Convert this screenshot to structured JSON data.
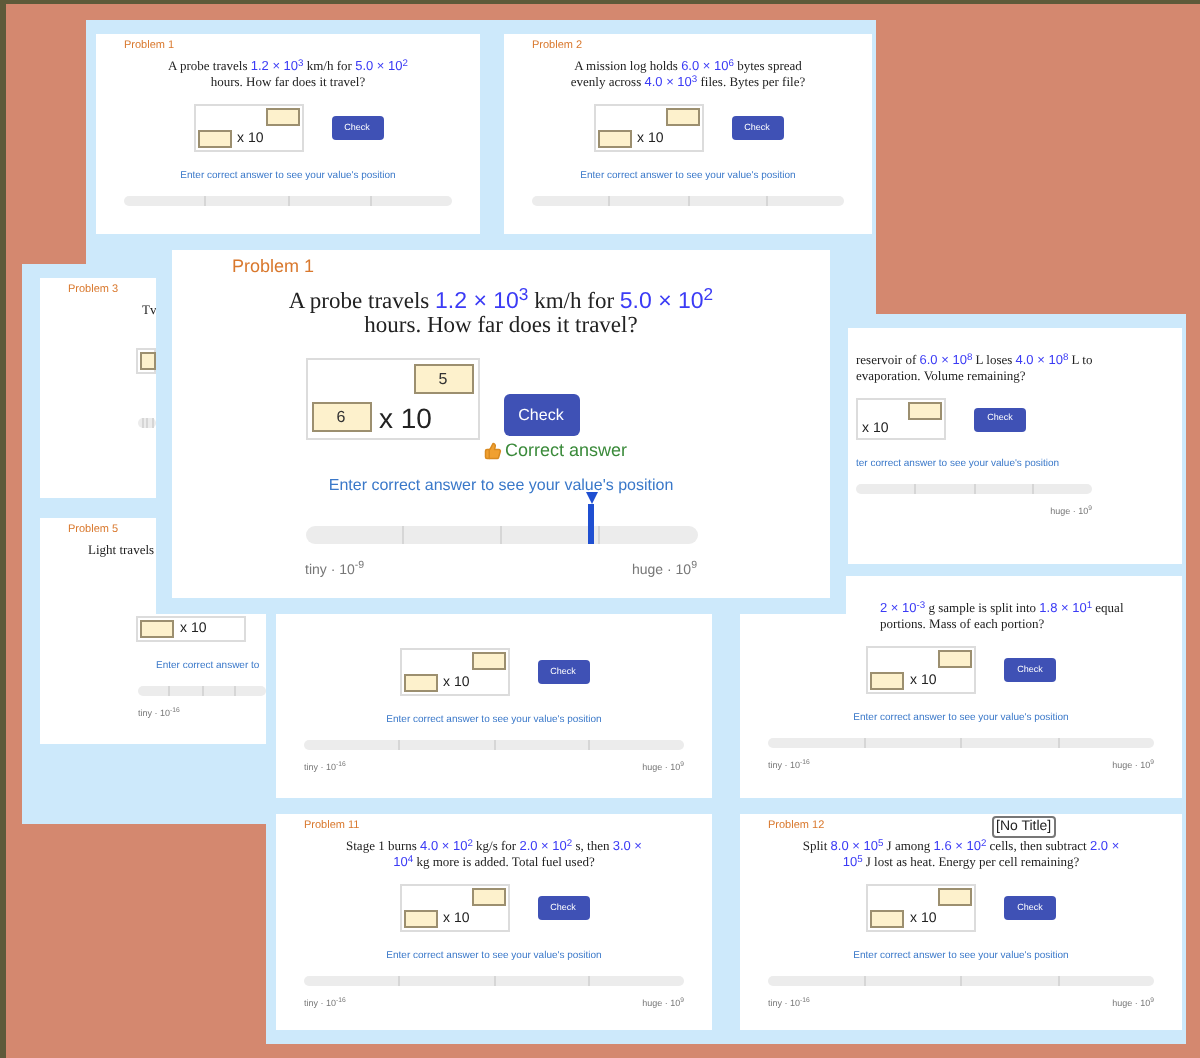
{
  "cards": [
    {
      "kind": "card",
      "label": "Problem 1",
      "question": [
        {
          "kind": "text",
          "text": "A probe travels "
        },
        {
          "kind": "value",
          "text": "1.2 × 10$^{3}$"
        },
        {
          "kind": "text",
          "text": " km/h for "
        },
        {
          "kind": "value",
          "text": "5.0 × 10$^{2}$"
        },
        {
          "kind": "text",
          "text": " hours. How far does it travel?"
        }
      ],
      "inputs": [
        {
          "kind": "exponent"
        },
        {
          "kind": "mantissa"
        }
      ],
      "base": "x 10",
      "check": "Check",
      "hint": "Enter correct answer to see your value's position",
      "scale_bar": true
    },
    {
      "kind": "card",
      "label": "Problem 2",
      "question": [
        {
          "kind": "text",
          "text": "A mission log holds "
        },
        {
          "kind": "value",
          "text": "6.0 × 10$^{6}$"
        },
        {
          "kind": "text",
          "text": " bytes spread evenly across "
        },
        {
          "kind": "value",
          "text": "4.0 × 10$^{3}$"
        },
        {
          "kind": "text",
          "text": " files. Bytes per file?"
        }
      ],
      "inputs": [
        {
          "kind": "exponent"
        },
        {
          "kind": "mantissa"
        }
      ],
      "base": "x 10",
      "check": "Check",
      "hint": "Enter correct answer to see your value's position",
      "scale_bar": true
    },
    {
      "kind": "card",
      "label": "Problem 3",
      "question": [
        {
          "kind": "text",
          "text": "Tv"
        }
      ],
      "inputs": [
        {
          "kind": "mantissa"
        }
      ],
      "scale_bar": true
    },
    {
      "kind": "card",
      "label": "Problem 5",
      "question": [
        {
          "kind": "text",
          "text": "Light travels"
        }
      ],
      "inputs": [
        {
          "kind": "mantissa"
        }
      ],
      "base": "x 10",
      "hint": "Enter correct answer to",
      "scale_bar": true,
      "min_label": "tiny · 10$^{-16}$"
    },
    {
      "kind": "card",
      "question": [
        {
          "kind": "text",
          "text": "reservoir of "
        },
        {
          "kind": "value",
          "text": "6.0 × 10$^{8}$"
        },
        {
          "kind": "text",
          "text": " L loses "
        },
        {
          "kind": "value",
          "text": "4.0 × 10$^{8}$"
        },
        {
          "kind": "text",
          "text": " L to evaporation. Volume remaining?"
        }
      ],
      "inputs": [
        {
          "kind": "exponent"
        }
      ],
      "base": "x 10",
      "check": "Check",
      "hint": "ter correct answer to see your value's position",
      "scale_bar": true,
      "max_label": "huge · 10$^{9}$"
    },
    {
      "kind": "card",
      "inputs": [
        {
          "kind": "exponent"
        },
        {
          "kind": "mantissa"
        }
      ],
      "base": "x 10",
      "check": "Check",
      "hint": "Enter correct answer to see your value's position",
      "scale_bar": true,
      "min_label": "tiny · 10$^{-16}$",
      "max_label": "huge · 10$^{9}$"
    },
    {
      "kind": "card",
      "question": [
        {
          "kind": "value",
          "text": "2 × 10$^{-3}$"
        },
        {
          "kind": "text",
          "text": " g sample is split into "
        },
        {
          "kind": "value",
          "text": "1.8 × 10$^{1}$"
        },
        {
          "kind": "text",
          "text": " equal portions. Mass of each portion?"
        }
      ],
      "inputs": [
        {
          "kind": "exponent"
        },
        {
          "kind": "mantissa"
        }
      ],
      "base": "x 10",
      "check": "Check",
      "hint": "Enter correct answer to see your value's position",
      "scale_bar": true,
      "min_label": "tiny · 10$^{-16}$",
      "max_label": "huge · 10$^{9}$"
    },
    {
      "kind": "card",
      "label": "Problem 11",
      "question": [
        {
          "kind": "text",
          "text": "Stage 1 burns "
        },
        {
          "kind": "value",
          "text": "4.0 × 10$^{2}$"
        },
        {
          "kind": "text",
          "text": " kg/s for "
        },
        {
          "kind": "value",
          "text": "2.0 × 10$^{2}$"
        },
        {
          "kind": "text",
          "text": " s, then "
        },
        {
          "kind": "value",
          "text": "3.0 × 10$^{4}$"
        },
        {
          "kind": "text",
          "text": " kg more is added. Total fuel used?"
        }
      ],
      "inputs": [
        {
          "kind": "exponent"
        },
        {
          "kind": "mantissa"
        }
      ],
      "base": "x 10",
      "check": "Check",
      "hint": "Enter correct answer to see your value's position",
      "scale_bar": true,
      "min_label": "tiny · 10$^{-16}$",
      "max_label": "huge · 10$^{9}$"
    },
    {
      "kind": "card",
      "label": "Problem 12",
      "tooltip": "[No Title]",
      "question": [
        {
          "kind": "text",
          "text": "Split "
        },
        {
          "kind": "value",
          "text": "8.0 × 10$^{5}$"
        },
        {
          "kind": "text",
          "text": " J among "
        },
        {
          "kind": "value",
          "text": "1.6 × 10$^{2}$"
        },
        {
          "kind": "text",
          "text": " cells, then subtract "
        },
        {
          "kind": "value",
          "text": "2.0 × 10$^{5}$"
        },
        {
          "kind": "text",
          "text": " J lost as heat. Energy per cell remaining?"
        }
      ],
      "inputs": [
        {
          "kind": "exponent"
        },
        {
          "kind": "mantissa"
        }
      ],
      "base": "x 10",
      "check": "Check",
      "hint": "Enter correct answer to see your value's position",
      "scale_bar": true,
      "min_label": "tiny · 10$^{-16}$",
      "max_label": "huge · 10$^{9}$"
    },
    {
      "kind": "focused",
      "label": "Problem 1",
      "question": [
        {
          "kind": "text",
          "text": "A probe travels "
        },
        {
          "kind": "value",
          "text": "1.2 × 10$^{3}$"
        },
        {
          "kind": "text",
          "text": " km/h for "
        },
        {
          "kind": "value",
          "text": "5.0 × 10$^{2}$"
        },
        {
          "kind": "text",
          "text": " hours. How far does it travel?"
        }
      ],
      "inputs": [
        {
          "kind": "exponent",
          "value": "5"
        },
        {
          "kind": "mantissa",
          "value": "6"
        }
      ],
      "base": "x 10",
      "check": "Check",
      "feedback": "Correct answer",
      "hint": "Enter correct answer to see your value's position",
      "scale_bar": true,
      "min_label": "tiny · 10$^{-9}$",
      "max_label": "huge · 10$^{9}$"
    }
  ]
}
